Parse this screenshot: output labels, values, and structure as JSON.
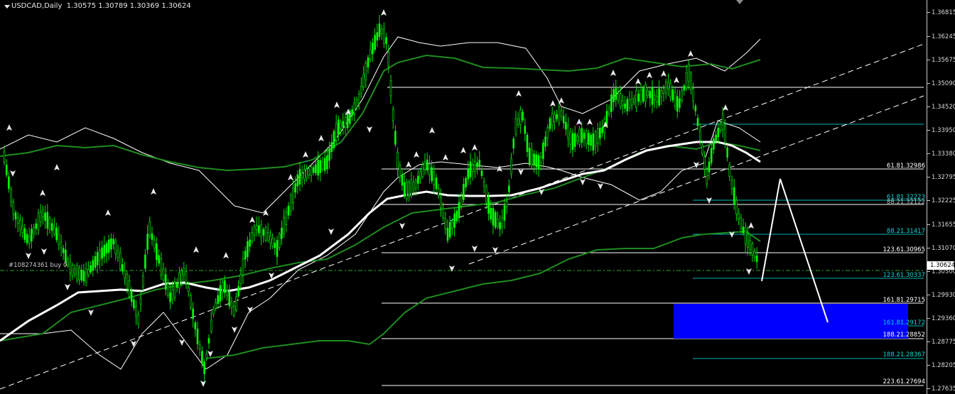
{
  "window": {
    "symbol": "USDCAD",
    "timeframe": "Daily",
    "title": "USDCAD,Daily  1.30575 1.30789 1.30369 1.30624",
    "colors": {
      "background": "#000000",
      "candles": "#00ff00",
      "ma_main": "#ffffff",
      "bands": "#ffffff",
      "bands_green": "#1e8c1e",
      "fib_white": "#ffffff",
      "fib_cyan": "#00cccc",
      "target_zone": "#0000ff"
    }
  },
  "order_line": {
    "label": "#108274361 buy 0."
  },
  "current_price": "1.30624",
  "price_axis": {
    "ticks": [
      "1.36815",
      "1.36245",
      "1.35675",
      "1.35090",
      "1.34520",
      "1.33950",
      "1.33380",
      "1.32795",
      "1.32225",
      "1.31655",
      "1.31070",
      "1.30500",
      "1.29930",
      "1.29360",
      "1.28775",
      "1.28205",
      "1.27635"
    ]
  },
  "fib_levels": [
    {
      "text": "61.81.32986",
      "color": "white"
    },
    {
      "text": "61.81.32223",
      "color": "cyan"
    },
    {
      "text": "88.21.32122",
      "color": "white"
    },
    {
      "text": "88.21.31417",
      "color": "cyan"
    },
    {
      "text": "123.61.30965",
      "color": "white"
    },
    {
      "text": "123.61.30337",
      "color": "cyan"
    },
    {
      "text": "161.81.29715",
      "color": "white"
    },
    {
      "text": "161.81.29172",
      "color": "cyan"
    },
    {
      "text": "188.21.28852",
      "color": "white"
    },
    {
      "text": "188.21.28367",
      "color": "cyan"
    },
    {
      "text": "223.61.27694",
      "color": "white"
    }
  ]
}
